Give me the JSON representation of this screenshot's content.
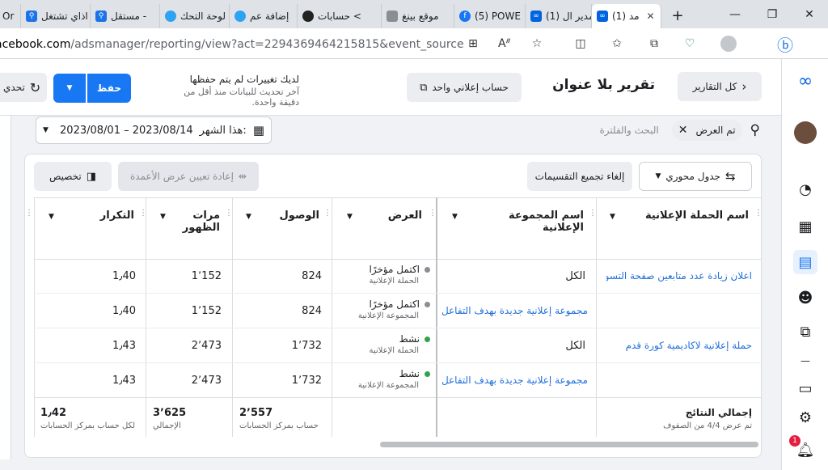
{
  "browser": {
    "tabs": [
      {
        "label": "Or",
        "color": "#5f6368"
      },
      {
        "label": "اذاي تشتغل",
        "color": "#1a73e8"
      },
      {
        "label": "مستقل -",
        "color": "#1a73e8"
      },
      {
        "label": "لوحة التحك",
        "color": "#2ea3f2"
      },
      {
        "label": "إضافة عم",
        "color": "#2ea3f2"
      },
      {
        "label": "حسابات <",
        "color": "#222222"
      },
      {
        "label": "موقع بينغ",
        "color": "#5f6368"
      },
      {
        "label": "(5) POWE",
        "color": "#1877f2"
      },
      {
        "label": "(1) مدير ال",
        "color": "#0064e0"
      },
      {
        "label": "(1) مد",
        "color": "#0064e0"
      }
    ],
    "url_host": "acebook.com",
    "url_rest": "/adsmanager/reporting/view?act=2294369464215815&event_source=AU..."
  },
  "header": {
    "all_reports": "كل التقارير",
    "title": "تقرير بلا عنوان",
    "single_account": "حساب إعلاني واحد",
    "unsaved_title": "لديك تغييرات لم يتم حفظها",
    "unsaved_sub": "آخر تحديث للبيانات منذ أقل من دقيقة واحدة.",
    "save": "حفظ",
    "refresh": "تحدي"
  },
  "filters": {
    "date_label": "هذا الشهر:",
    "date_range": "2023/08/01 – 2023/08/14",
    "chip": "تم العرض",
    "search_placeholder": "البحث والفلترة"
  },
  "toolbar": {
    "layout": "جدول محوري",
    "ungroup": "إلغاء تجميع التقسيمات",
    "reset_columns": "إعادة تعيين عرض الأعمدة",
    "customize": "تخصيص"
  },
  "columns": {
    "campaign": "اسم الحملة الإعلانية",
    "adset": "اسم المجموعة الإعلانية",
    "delivery": "العرض",
    "reach": "الوصول",
    "impressions": "مرات الظهور",
    "frequency": "التكرار"
  },
  "rows": [
    {
      "campaign": "اعلان زيادة عدد متابعين صفحة التسو...",
      "adset": "الكل",
      "status": "اكتمل مؤخرًا",
      "level": "الحملة الإعلانية",
      "status_color": "#8a8d91",
      "reach": "824",
      "impressions": "1٬152",
      "frequency": "1٫40"
    },
    {
      "campaign": "",
      "adset": "مجموعة إعلانية جديدة بهدف التفاعل",
      "status": "اكتمل مؤخرًا",
      "level": "المجموعة الإعلانية",
      "status_color": "#8a8d91",
      "reach": "824",
      "impressions": "1٬152",
      "frequency": "1٫40"
    },
    {
      "campaign": "حملة إعلانية لاكاديمية كورة قدم",
      "adset": "الكل",
      "status": "نشط",
      "level": "الحملة الإعلانية",
      "status_color": "#31a24c",
      "reach": "1٬732",
      "impressions": "2٬473",
      "frequency": "1٫43"
    },
    {
      "campaign": "",
      "adset": "مجموعة إعلانية جديدة بهدف التفاعل",
      "status": "نشط",
      "level": "المجموعة الإعلانية",
      "status_color": "#31a24c",
      "reach": "1٬732",
      "impressions": "2٬473",
      "frequency": "1٫43"
    }
  ],
  "summary": {
    "label": "إجمالي النتائج",
    "sub": "تم عرض 4/4 من الصفوف",
    "reach": "2٬557",
    "reach_note": "حساب بمركز الحسابات",
    "impressions": "3٬625",
    "impressions_note": "الإجمالي",
    "frequency": "1٫42",
    "frequency_note": "لكل حساب بمركز الحسابات"
  },
  "notifications_count": "1"
}
